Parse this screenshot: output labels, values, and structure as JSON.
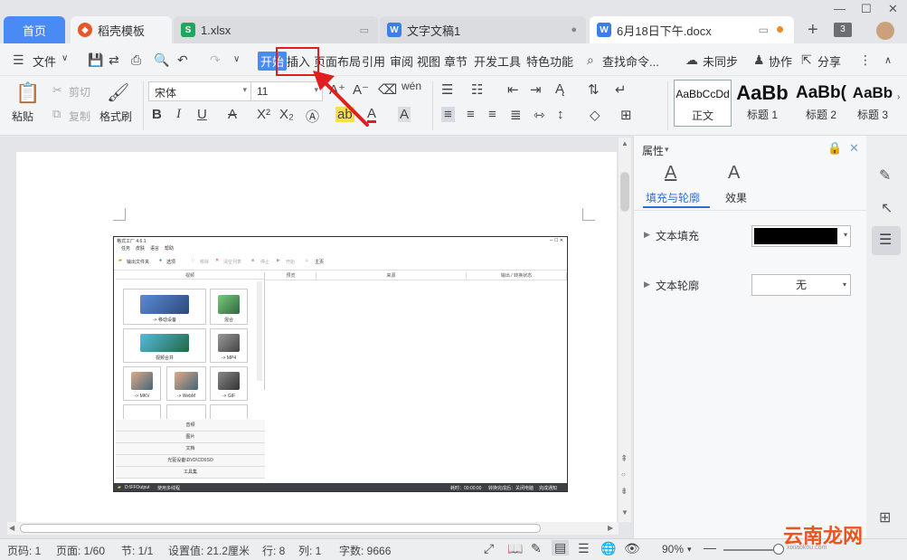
{
  "tabs": {
    "home": "首页",
    "docer": "稻壳模板",
    "xlsx": "1.xlsx",
    "doc1": "文字文稿1",
    "active_doc": "6月18日下午.docx",
    "tab_count": "3"
  },
  "menu": {
    "file": "文件",
    "items": [
      "开始",
      "插入",
      "页面布局",
      "引用",
      "审阅",
      "视图",
      "章节",
      "开发工具",
      "特色功能"
    ],
    "search": "查找命令...",
    "sync": "未同步",
    "collab": "协作",
    "share": "分享"
  },
  "ribbon": {
    "paste": "粘贴",
    "cut": "剪切",
    "copy": "复制",
    "format_painter": "格式刷",
    "font_name": "宋体",
    "font_size": "11",
    "styles": [
      {
        "preview": "AaBbCcDd",
        "name": "正文"
      },
      {
        "preview": "AaBb",
        "name": "标题 1"
      },
      {
        "preview": "AaBb(",
        "name": "标题 2"
      },
      {
        "preview": "AaBb",
        "name": "标题 3"
      }
    ]
  },
  "embedded": {
    "title": "格式工厂 4.6.1",
    "menus": [
      "任务",
      "皮肤",
      "语言",
      "帮助"
    ],
    "tools": [
      "输出文件夹",
      "选项",
      "移除",
      "清空列表",
      "停止",
      "开始",
      "主页"
    ],
    "cells": [
      "-> 移动设备",
      "混合",
      "视频合并",
      "-> MP4",
      "-> MKV",
      "-> WebM",
      "-> GIF"
    ],
    "left_header": "视频",
    "cats": [
      "音频",
      "图片",
      "文档",
      "光驱设备\\DVD\\CD\\ISO",
      "工具集"
    ],
    "cols": [
      "预览",
      "来源",
      "输出 / 转换状态"
    ],
    "status_path": "D:\\FFOutput",
    "status_multi": "使用多线程",
    "status_time": "耗时：00:00:00",
    "status_after": "转换完成后：关闭电脑",
    "status_notify": "完成通知"
  },
  "panel": {
    "title": "属性",
    "tab_fill": "填充与轮廓",
    "tab_effect": "效果",
    "text_fill": "文本填充",
    "text_outline": "文本轮廓",
    "outline_value": "无",
    "fill_color": "#000000"
  },
  "status": {
    "page_num": "页码: 1",
    "pages": "页面: 1/60",
    "section": "节: 1/1",
    "setting": "设置值: 21.2厘米",
    "row": "行: 8",
    "col": "列: 1",
    "words": "字数: 9666",
    "zoom": "90%"
  },
  "watermark": {
    "text": "云南龙网",
    "sub": "xixiaokou.com"
  }
}
